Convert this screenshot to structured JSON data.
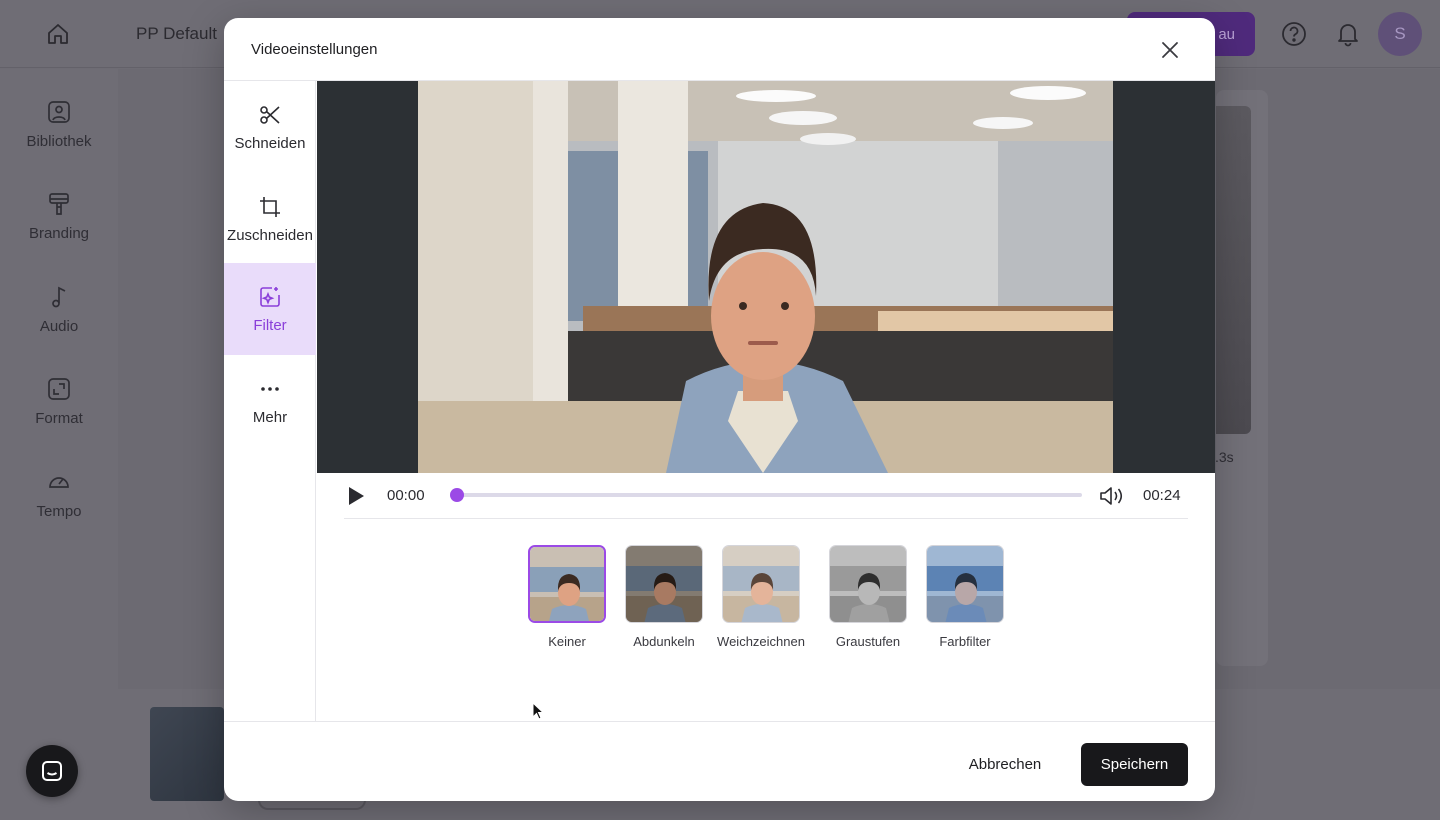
{
  "app": {
    "title": "PP Default",
    "upgrade_label": "au",
    "avatar_initial": "S",
    "sidebar": [
      {
        "label": "Bibliothek",
        "icon": "image-icon"
      },
      {
        "label": "Branding",
        "icon": "paint-roller-icon"
      },
      {
        "label": "Audio",
        "icon": "music-note-icon"
      },
      {
        "label": "Format",
        "icon": "resize-icon"
      },
      {
        "label": "Tempo",
        "icon": "speedometer-icon"
      }
    ],
    "background_duration": ".3s"
  },
  "modal": {
    "title": "Videoeinstellungen",
    "tools": [
      {
        "label": "Schneiden",
        "icon": "scissors-icon",
        "active": false
      },
      {
        "label": "Zuschneiden",
        "icon": "crop-icon",
        "active": false
      },
      {
        "label": "Filter",
        "icon": "sparkle-image-icon",
        "active": true
      },
      {
        "label": "Mehr",
        "icon": "more-dots-icon",
        "active": false
      }
    ],
    "player": {
      "current_time": "00:00",
      "total_time": "00:24",
      "progress": 0.0
    },
    "filters": [
      {
        "label": "Keiner",
        "selected": true
      },
      {
        "label": "Abdunkeln",
        "selected": false
      },
      {
        "label": "Weichzeichnen",
        "selected": false
      },
      {
        "label": "Graustufen",
        "selected": false
      },
      {
        "label": "Farbfilter",
        "selected": false
      }
    ],
    "footer": {
      "cancel_label": "Abbrechen",
      "save_label": "Speichern"
    }
  },
  "colors": {
    "accent": "#9b4ae6",
    "active_tool_bg": "#e9dcfa",
    "primary_button": "#18181b"
  }
}
